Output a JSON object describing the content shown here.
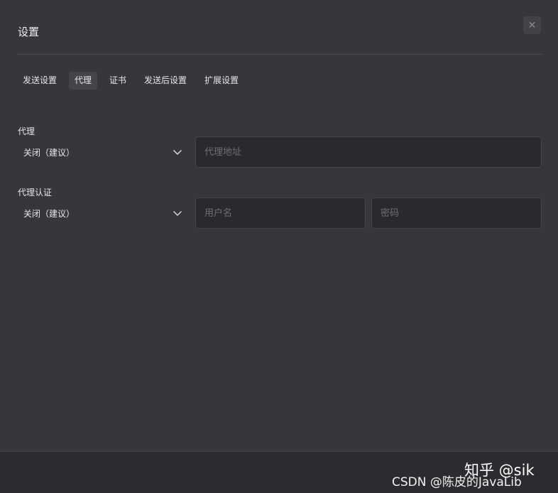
{
  "dialog": {
    "title": "设置",
    "close_symbol": "✕"
  },
  "tabs": [
    {
      "label": "发送设置",
      "active": false
    },
    {
      "label": "代理",
      "active": true
    },
    {
      "label": "证书",
      "active": false
    },
    {
      "label": "发送后设置",
      "active": false
    },
    {
      "label": "扩展设置",
      "active": false
    }
  ],
  "proxy": {
    "label": "代理",
    "select_value": "关闭（建议）",
    "address_placeholder": "代理地址"
  },
  "proxy_auth": {
    "label": "代理认证",
    "select_value": "关闭（建议）",
    "username_placeholder": "用户名",
    "password_placeholder": "密码"
  },
  "watermarks": {
    "zhihu": "知乎 @sik",
    "csdn": "CSDN @陈皮的JavaLib"
  },
  "icons": {
    "close": "close-icon",
    "chevron": "chevron-down-icon"
  }
}
